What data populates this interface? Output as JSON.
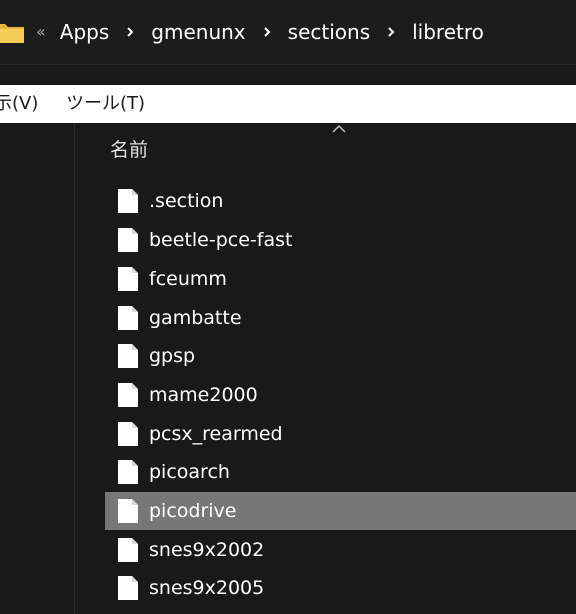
{
  "addressbar": {
    "overflow": "«",
    "crumbs": [
      "Apps",
      "gmenunx",
      "sections",
      "libretro"
    ]
  },
  "menubar": {
    "view_label": "示(V)",
    "tools_label": "ツール(T)"
  },
  "columns": {
    "name_header": "名前"
  },
  "files": [
    {
      "name": ".section",
      "selected": false
    },
    {
      "name": "beetle-pce-fast",
      "selected": false
    },
    {
      "name": "fceumm",
      "selected": false
    },
    {
      "name": "gambatte",
      "selected": false
    },
    {
      "name": "gpsp",
      "selected": false
    },
    {
      "name": "mame2000",
      "selected": false
    },
    {
      "name": "pcsx_rearmed",
      "selected": false
    },
    {
      "name": "picoarch",
      "selected": false
    },
    {
      "name": "picodrive",
      "selected": true
    },
    {
      "name": "snes9x2002",
      "selected": false
    },
    {
      "name": "snes9x2005",
      "selected": false
    }
  ],
  "colors": {
    "background": "#191919",
    "selected_row": "#777777",
    "menubar": "#ffffff",
    "folder": "#f4c542"
  }
}
